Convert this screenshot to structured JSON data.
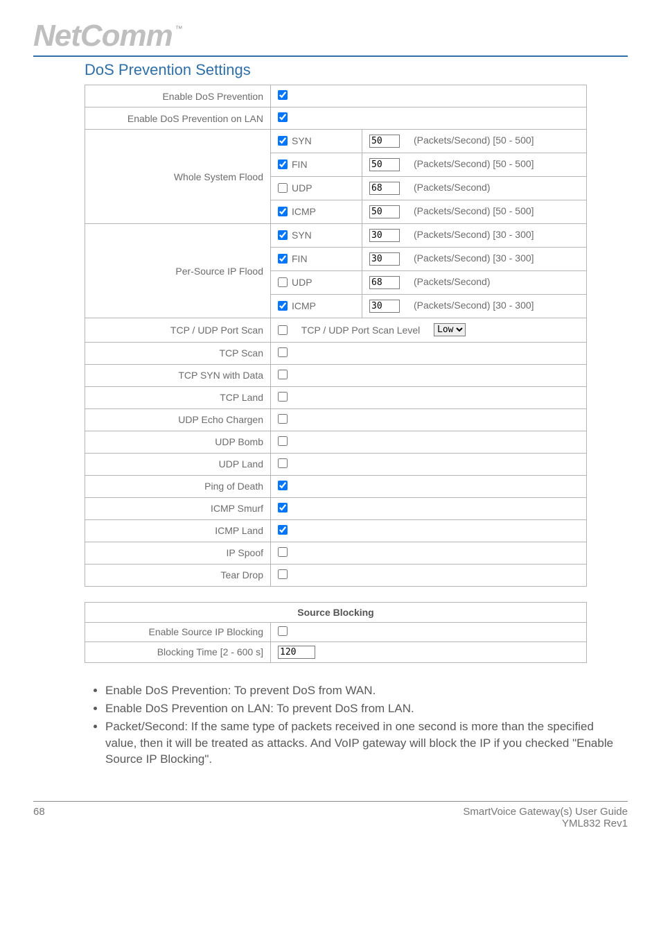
{
  "brand": {
    "name": "NetComm",
    "tm": "™"
  },
  "section_title": "DoS Prevention Settings",
  "rows": {
    "enable_dos": {
      "label": "Enable DoS Prevention",
      "checked": true
    },
    "enable_dos_lan": {
      "label": "Enable DoS Prevention on LAN",
      "checked": true
    },
    "whole_flood_label": "Whole System Flood",
    "per_source_label": "Per-Source IP Flood",
    "wf": {
      "syn": {
        "label": "SYN",
        "checked": true,
        "val": "50",
        "unit": "(Packets/Second) [50 - 500]"
      },
      "fin": {
        "label": "FIN",
        "checked": true,
        "val": "50",
        "unit": "(Packets/Second) [50 - 500]"
      },
      "udp": {
        "label": "UDP",
        "checked": false,
        "val": "68",
        "unit": "(Packets/Second)"
      },
      "icmp": {
        "label": "ICMP",
        "checked": true,
        "val": "50",
        "unit": "(Packets/Second) [50 - 500]"
      }
    },
    "ps": {
      "syn": {
        "label": "SYN",
        "checked": true,
        "val": "30",
        "unit": "(Packets/Second) [30 - 300]"
      },
      "fin": {
        "label": "FIN",
        "checked": true,
        "val": "30",
        "unit": "(Packets/Second) [30 - 300]"
      },
      "udp": {
        "label": "UDP",
        "checked": false,
        "val": "68",
        "unit": "(Packets/Second)"
      },
      "icmp": {
        "label": "ICMP",
        "checked": true,
        "val": "30",
        "unit": "(Packets/Second) [30 - 300]"
      }
    },
    "portscan": {
      "label": "TCP / UDP Port Scan",
      "checked": false,
      "level_label": "TCP / UDP Port Scan Level",
      "level_value": "Low"
    },
    "simple": {
      "tcp_scan": {
        "label": "TCP Scan",
        "checked": false
      },
      "tcp_syn_data": {
        "label": "TCP SYN with Data",
        "checked": false
      },
      "tcp_land": {
        "label": "TCP Land",
        "checked": false
      },
      "udp_echo": {
        "label": "UDP Echo Chargen",
        "checked": false
      },
      "udp_bomb": {
        "label": "UDP Bomb",
        "checked": false
      },
      "udp_land": {
        "label": "UDP Land",
        "checked": false
      },
      "ping_death": {
        "label": "Ping of Death",
        "checked": true
      },
      "icmp_smurf": {
        "label": "ICMP Smurf",
        "checked": true
      },
      "icmp_land": {
        "label": "ICMP Land",
        "checked": true
      },
      "ip_spoof": {
        "label": "IP Spoof",
        "checked": false
      },
      "tear_drop": {
        "label": "Tear Drop",
        "checked": false
      }
    }
  },
  "source_blocking": {
    "title": "Source Blocking",
    "enable": {
      "label": "Enable Source IP Blocking",
      "checked": false
    },
    "time": {
      "label": "Blocking Time [2 - 600 s]",
      "val": "120"
    }
  },
  "bullets": [
    "Enable DoS Prevention: To prevent DoS from WAN.",
    "Enable DoS Prevention on LAN: To prevent DoS from LAN.",
    "Packet/Second: If the same type of packets received in one second is more than the specified value, then it will be treated as attacks. And VoIP gateway will block the IP if you checked \"Enable Source IP Blocking\"."
  ],
  "footer": {
    "page": "68",
    "guide": "SmartVoice Gateway(s) User Guide",
    "rev": "YML832 Rev1"
  }
}
